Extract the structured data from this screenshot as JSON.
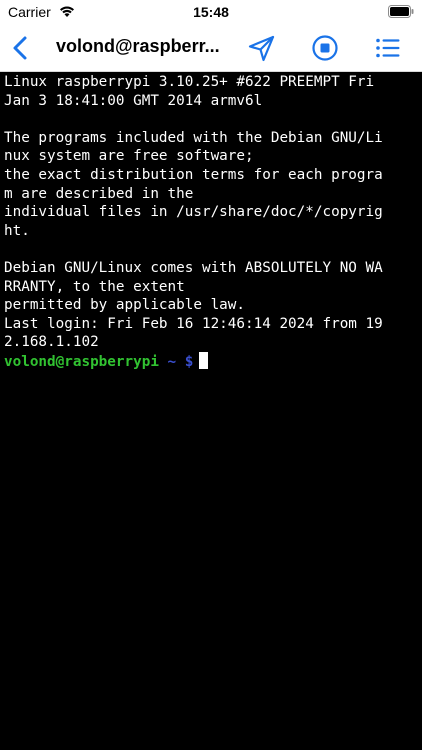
{
  "status_bar": {
    "carrier": "Carrier",
    "time": "15:48"
  },
  "nav": {
    "title": "volond@raspberr..."
  },
  "terminal": {
    "lines": [
      "Linux raspberrypi 3.10.25+ #622 PREEMPT Fri",
      "Jan 3 18:41:00 GMT 2014 armv6l",
      "",
      "The programs included with the Debian GNU/Li",
      "nux system are free software;",
      "the exact distribution terms for each progra",
      "m are described in the",
      "individual files in /usr/share/doc/*/copyrig",
      "ht.",
      "",
      "Debian GNU/Linux comes with ABSOLUTELY NO WA",
      "RRANTY, to the extent",
      "permitted by applicable law.",
      "Last login: Fri Feb 16 12:46:14 2024 from 19",
      "2.168.1.102"
    ],
    "prompt_user": "volond@raspberrypi",
    "prompt_path": "~ $"
  },
  "colors": {
    "accent": "#1a73e8",
    "prompt_user": "#31c231",
    "prompt_path": "#3a4fd0",
    "terminal_bg": "#000000"
  },
  "icons": [
    "wifi-icon",
    "battery-icon",
    "back-chevron-icon",
    "send-icon",
    "stop-icon",
    "list-icon"
  ]
}
